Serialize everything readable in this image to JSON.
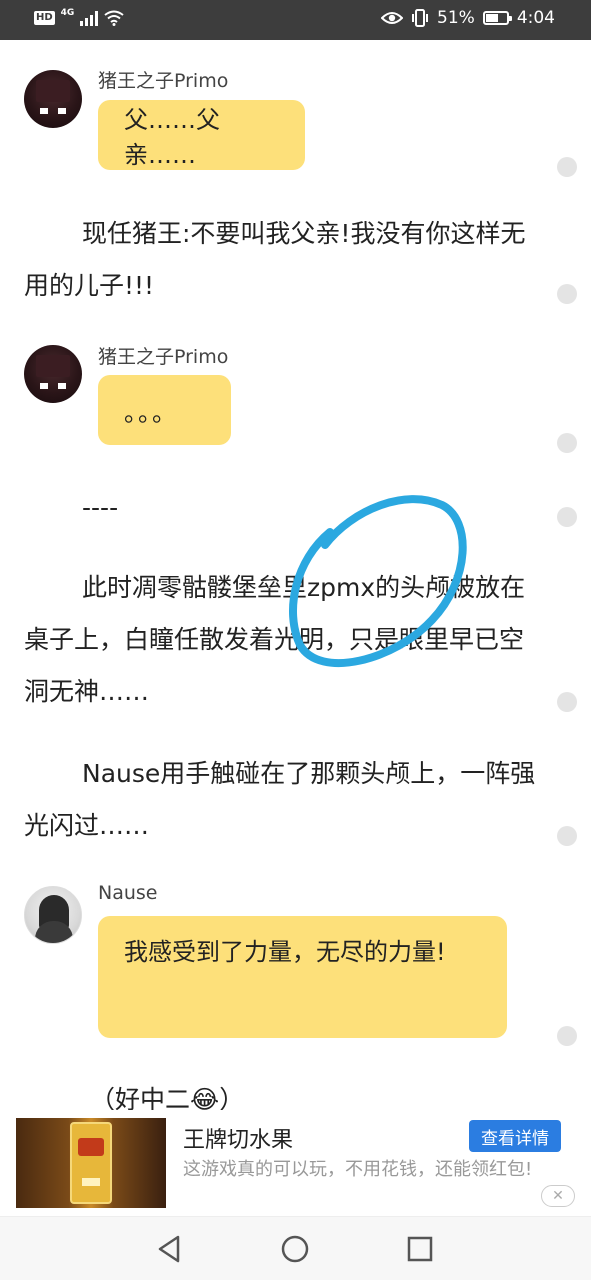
{
  "status_bar": {
    "hd": "HD",
    "network": "4G",
    "battery_percent": "51%",
    "time": "4:04"
  },
  "messages": [
    {
      "sender": "猪王之子Primo",
      "text": "父……父亲……"
    },
    {
      "text": "现任猪王:不要叫我父亲!我没有你这样无用的儿子!!!"
    },
    {
      "sender": "猪王之子Primo",
      "text": "。。。"
    },
    {
      "text": "----"
    },
    {
      "text": "此时凋零骷髅堡垒里zpmx的头颅被放在桌子上，白瞳任散发着光明，只是眼里早已空洞无神……"
    },
    {
      "text": "Nause用手触碰在了那颗头颅上，一阵强光闪过……"
    },
    {
      "sender": "Nause",
      "text": "我感受到了力量，无尽的力量!"
    },
    {
      "text": "（好中二😂）"
    }
  ],
  "ad": {
    "title": "王牌切水果",
    "description": "这游戏真的可以玩，不用花钱，还能领红包!",
    "button": "查看详情",
    "close": "✕"
  },
  "colors": {
    "bubble": "#fde07a",
    "status_bar": "#3d3d3d",
    "scribble": "#2ba8e0",
    "ad_button": "#2b7de1"
  },
  "icons": [
    "back-icon",
    "home-icon",
    "recents-icon",
    "eye-icon",
    "vibrate-icon",
    "wifi-icon",
    "signal-icon",
    "battery-icon"
  ]
}
